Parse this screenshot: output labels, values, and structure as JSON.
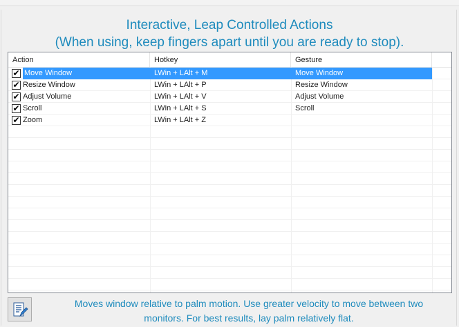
{
  "title": {
    "line1": "Interactive, Leap Controlled Actions",
    "line2": "(When using, keep fingers apart until you are ready to stop)."
  },
  "list": {
    "columns": [
      "Action",
      "Hotkey",
      "Gesture"
    ],
    "rows": [
      {
        "checked": true,
        "action": "Move Window",
        "hotkey": "LWin + LAlt + M",
        "gesture": "Move Window",
        "selected": true
      },
      {
        "checked": true,
        "action": "Resize Window",
        "hotkey": "LWin + LAlt + P",
        "gesture": "Resize Window",
        "selected": false
      },
      {
        "checked": true,
        "action": "Adjust Volume",
        "hotkey": "LWin + LAlt + V",
        "gesture": "Adjust Volume",
        "selected": false
      },
      {
        "checked": true,
        "action": "Scroll",
        "hotkey": "LWin + LAlt + S",
        "gesture": "Scroll",
        "selected": false
      },
      {
        "checked": true,
        "action": "Zoom",
        "hotkey": "LWin + LAlt + Z",
        "gesture": "",
        "selected": false
      }
    ]
  },
  "description": {
    "line1": "Moves window relative to palm motion. Use greater velocity to move between two",
    "line2": "monitors. For best results, lay palm relatively flat."
  },
  "icons": {
    "help_button": "edit-document-icon",
    "checkbox": "checkmark-icon"
  },
  "colors": {
    "accent_text": "#1e8bbd",
    "selection": "#3399ff"
  }
}
